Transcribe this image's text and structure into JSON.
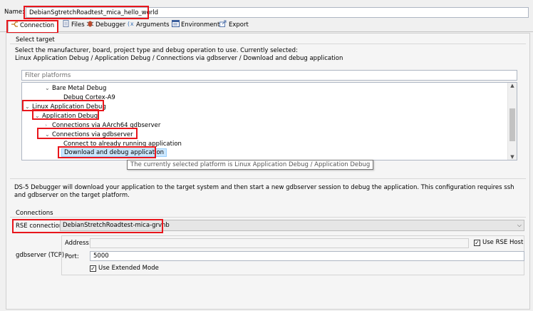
{
  "config": {
    "name_label": "Name:",
    "name_value": "DebianSgtretchRoadtest_mica_hello_world"
  },
  "tabs": [
    {
      "label": "Connection",
      "icon": "connection-icon",
      "active": true
    },
    {
      "label": "Files",
      "icon": "files-icon"
    },
    {
      "label": "Debugger",
      "icon": "bug-icon"
    },
    {
      "label": "Arguments",
      "icon": "arguments-icon"
    },
    {
      "label": "Environment",
      "icon": "environment-icon"
    },
    {
      "label": "Export",
      "icon": "export-icon"
    }
  ],
  "select_target": {
    "group_title": "Select target",
    "instructions": "Select the manufacturer, board, project type and debug operation to use. Currently selected:",
    "current_selection": "Linux Application Debug / Application Debug / Connections via gdbserver / Download and debug application",
    "filter_placeholder": "Filter platforms",
    "tree": [
      "Bare Metal Debug",
      "Debug Cortex-A9",
      "Linux Application Debug",
      "Application Debug",
      "Connections via AArch64 gdbserver",
      "Connections via gdbserver",
      "Connect to already running application",
      "Download and debug application"
    ],
    "tooltip": "The currently selected platform is Linux Application Debug / Application Debug"
  },
  "description": "DS-5 Debugger will download your application to the target system and then start a new gdbserver session to debug the application. This configuration requires ssh and gdbserver on the target platform.",
  "connections": {
    "group_title": "Connections",
    "rse_label": "RSE connection",
    "rse_value": "DebianStretchRoadtest-mica-grvnb",
    "gdbserver_label": "gdbserver (TCP)",
    "address_label": "Address:",
    "address_value": "",
    "use_rse_host_label": "Use RSE Host",
    "port_label": "Port:",
    "port_value": "5000",
    "extended_mode_label": "Use Extended Mode"
  },
  "colors": {
    "highlight_box": "#e8161c",
    "selection": "#cce8ff"
  }
}
